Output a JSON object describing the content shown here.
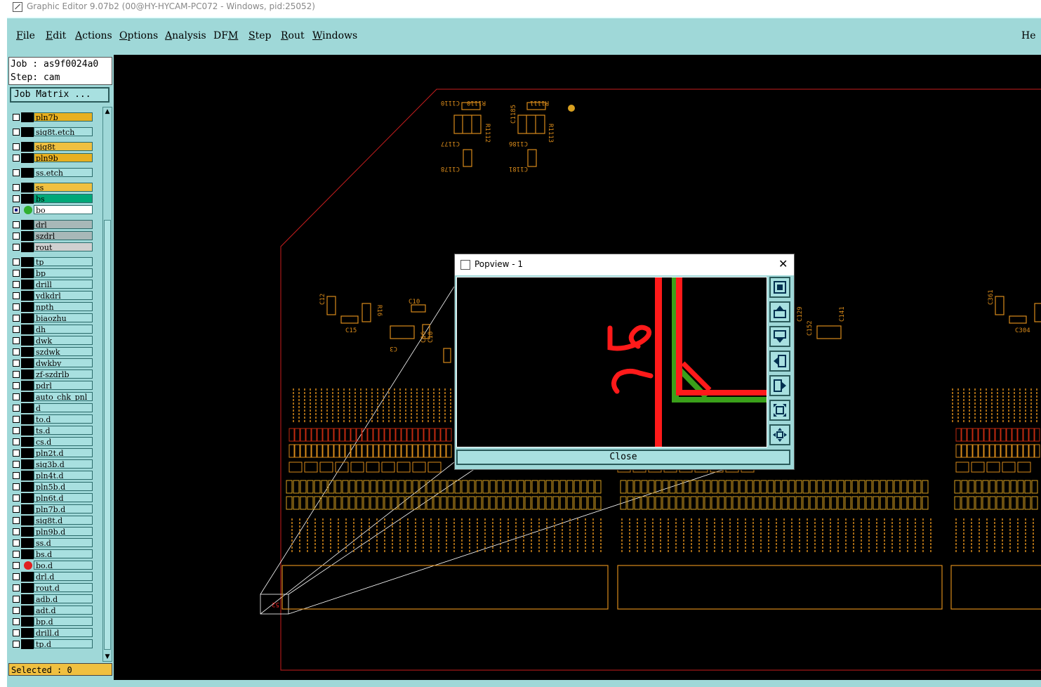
{
  "window": {
    "title": "Graphic Editor 9.07b2 (00@HY-HYCAM-PC072 - Windows, pid:25052)"
  },
  "menu": {
    "items": [
      {
        "pre": "",
        "u": "F",
        "post": "ile"
      },
      {
        "pre": "",
        "u": "E",
        "post": "dit"
      },
      {
        "pre": "",
        "u": "A",
        "post": "ctions"
      },
      {
        "pre": "",
        "u": "O",
        "post": "ptions"
      },
      {
        "pre": "",
        "u": "A",
        "post": "nalysis"
      },
      {
        "pre": "DF",
        "u": "M",
        "post": ""
      },
      {
        "pre": "",
        "u": "S",
        "post": "tep"
      },
      {
        "pre": "",
        "u": "R",
        "post": "out"
      },
      {
        "pre": "",
        "u": "W",
        "post": "indows"
      }
    ],
    "help_partial": "He"
  },
  "job": {
    "job_line": "Job : as9f0024a0",
    "step_line": "Step: cam",
    "matrix_button": "Job Matrix ..."
  },
  "layers": [
    {
      "name": "pln7b",
      "color": "#e8b020"
    },
    {
      "name": "sig8t.etch",
      "color": "#a8e0e0"
    },
    {
      "name": "sig8t",
      "color": "#f0c040"
    },
    {
      "name": "pln9b",
      "color": "#e8b020"
    },
    {
      "name": "ss.etch",
      "color": "#a8e0e0"
    },
    {
      "name": "ss",
      "color": "#f0c040"
    },
    {
      "name": "bs",
      "color": "#00a878"
    },
    {
      "name": "bo",
      "color": "#ffffff",
      "selected": true,
      "dot": "#30b030"
    },
    {
      "name": "drl",
      "color": "#a8b8b8"
    },
    {
      "name": "szdrl",
      "color": "#a8b8b8"
    },
    {
      "name": "rout",
      "color": "#d0d0d0"
    },
    {
      "name": "tp",
      "color": "#a8e0e0"
    },
    {
      "name": "bp",
      "color": "#a8e0e0"
    },
    {
      "name": "drill",
      "color": "#a8e0e0"
    },
    {
      "name": "ydkdrl",
      "color": "#a8e0e0"
    },
    {
      "name": "npth",
      "color": "#a8e0e0"
    },
    {
      "name": "biaozhu",
      "color": "#a8e0e0"
    },
    {
      "name": "dh",
      "color": "#a8e0e0"
    },
    {
      "name": "dwk",
      "color": "#a8e0e0"
    },
    {
      "name": "szdwk",
      "color": "#a8e0e0"
    },
    {
      "name": "dwkby",
      "color": "#a8e0e0"
    },
    {
      "name": "zf-szdrlb",
      "color": "#a8e0e0"
    },
    {
      "name": "pdrl",
      "color": "#a8e0e0"
    },
    {
      "name": "auto_chk_pnl",
      "color": "#a8e0e0"
    },
    {
      "name": "d",
      "color": "#a8e0e0"
    },
    {
      "name": "to.d",
      "color": "#a8e0e0"
    },
    {
      "name": "ts.d",
      "color": "#a8e0e0"
    },
    {
      "name": "cs.d",
      "color": "#a8e0e0"
    },
    {
      "name": "pln2t.d",
      "color": "#a8e0e0"
    },
    {
      "name": "sig3b.d",
      "color": "#a8e0e0"
    },
    {
      "name": "pln4t.d",
      "color": "#a8e0e0"
    },
    {
      "name": "pln5b.d",
      "color": "#a8e0e0"
    },
    {
      "name": "pln6t.d",
      "color": "#a8e0e0"
    },
    {
      "name": "pln7b.d",
      "color": "#a8e0e0"
    },
    {
      "name": "sig8t.d",
      "color": "#a8e0e0"
    },
    {
      "name": "pln9b.d",
      "color": "#a8e0e0"
    },
    {
      "name": "ss.d",
      "color": "#a8e0e0"
    },
    {
      "name": "bs.d",
      "color": "#a8e0e0"
    },
    {
      "name": "bo.d",
      "color": "#a8e0e0",
      "dot": "#e02020"
    },
    {
      "name": "drl.d",
      "color": "#a8e0e0"
    },
    {
      "name": "rout.d",
      "color": "#a8e0e0"
    },
    {
      "name": "adb.d",
      "color": "#a8e0e0"
    },
    {
      "name": "adt.d",
      "color": "#a8e0e0"
    },
    {
      "name": "bp.d",
      "color": "#a8e0e0"
    },
    {
      "name": "drill.d",
      "color": "#a8e0e0"
    },
    {
      "name": "tp.d",
      "color": "#a8e0e0"
    }
  ],
  "status": {
    "selected": "Selected : 0"
  },
  "canvas_labels": {
    "top_parts": [
      "C1110",
      "R1110",
      "R1112",
      "C1177",
      "C1186",
      "R1111",
      "C1185",
      "R1113",
      "C1178",
      "C1181"
    ],
    "left_parts": [
      "C12",
      "C15",
      "R16",
      "C10",
      "C3",
      "C16",
      "C18"
    ],
    "right_parts": [
      "C129",
      "C152",
      "C141",
      "C361",
      "C304"
    ],
    "popview_text": "52"
  },
  "popview": {
    "title": "Popview - 1",
    "close_x": "✕",
    "close_button": "Close"
  },
  "colors": {
    "panel": "#9fd8d8",
    "canvas": "#000000",
    "board_outline": "#c81e1e",
    "silkscreen": "#d88a1a",
    "popview_trace_red": "#ff1a1a",
    "popview_trace_green": "#3aa01a"
  }
}
